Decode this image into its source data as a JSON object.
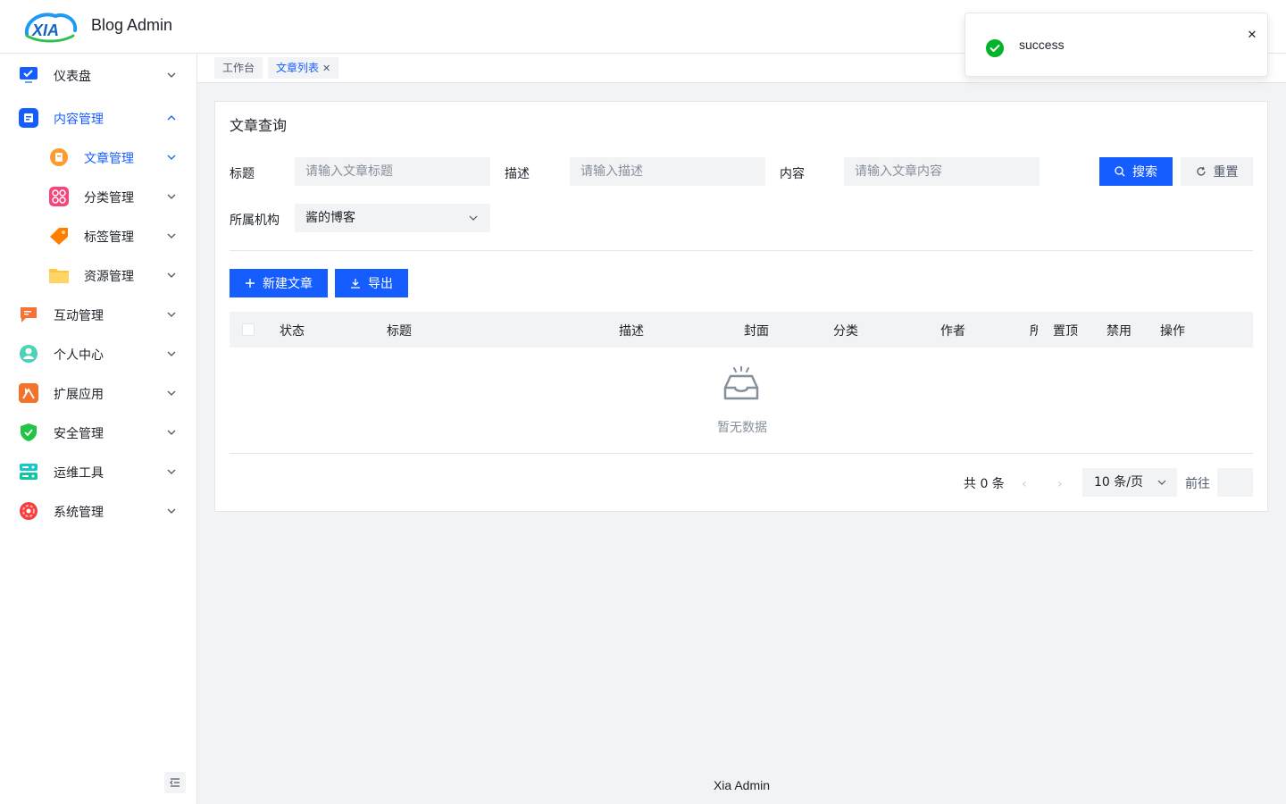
{
  "header": {
    "logo_text": "XIA",
    "app_title": "Blog Admin"
  },
  "sidebar": {
    "items": [
      {
        "label": "仪表盘",
        "icon": "monitor-icon"
      },
      {
        "label": "内容管理",
        "icon": "document-icon",
        "expanded": true
      },
      {
        "label": "文章管理",
        "icon": "article-icon",
        "active": true
      },
      {
        "label": "分类管理",
        "icon": "category-grid-icon"
      },
      {
        "label": "标签管理",
        "icon": "tag-icon"
      },
      {
        "label": "资源管理",
        "icon": "folder-icon"
      },
      {
        "label": "互动管理",
        "icon": "chat-icon"
      },
      {
        "label": "个人中心",
        "icon": "user-icon"
      },
      {
        "label": "扩展应用",
        "icon": "extension-icon"
      },
      {
        "label": "安全管理",
        "icon": "shield-icon"
      },
      {
        "label": "运维工具",
        "icon": "server-icon"
      },
      {
        "label": "系统管理",
        "icon": "settings-icon"
      }
    ]
  },
  "tabs": [
    {
      "label": "工作台",
      "active": false
    },
    {
      "label": "文章列表",
      "active": true
    }
  ],
  "card": {
    "title": "文章查询",
    "filters": {
      "title_label": "标题",
      "title_placeholder": "请输入文章标题",
      "desc_label": "描述",
      "desc_placeholder": "请输入描述",
      "content_label": "内容",
      "content_placeholder": "请输入文章内容",
      "org_label": "所属机构",
      "org_value": "酱的博客"
    },
    "search_button": "搜索",
    "reset_button": "重置",
    "new_button": "新建文章",
    "export_button": "导出",
    "columns": [
      "状态",
      "标题",
      "描述",
      "封面",
      "分类",
      "作者",
      "所",
      "置顶",
      "禁用",
      "操作"
    ],
    "empty_text": "暂无数据"
  },
  "pagination": {
    "total": "共 0 条",
    "page_size": "10 条/页",
    "goto_label": "前往"
  },
  "footer": "Xia Admin",
  "notification": {
    "message": "success",
    "type": "success"
  },
  "colors": {
    "primary": "#165dff",
    "success": "#00b42a",
    "background": "#f2f3f5"
  }
}
